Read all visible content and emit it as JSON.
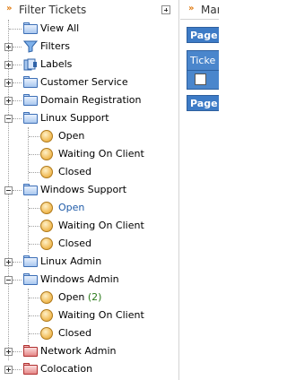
{
  "panel": {
    "title": "Filter Tickets"
  },
  "tree": {
    "view_all": "View All",
    "filters": "Filters",
    "labels": "Labels",
    "customer_service": "Customer Service",
    "domain_registration": "Domain Registration",
    "linux_support": {
      "label": "Linux Support",
      "open": "Open",
      "waiting": "Waiting On Client",
      "closed": "Closed"
    },
    "windows_support": {
      "label": "Windows Support",
      "open": "Open",
      "waiting": "Waiting On Client",
      "closed": "Closed"
    },
    "linux_admin": "Linux Admin",
    "windows_admin": {
      "label": "Windows Admin",
      "open": "Open",
      "open_count": "(2)",
      "waiting": "Waiting On Client",
      "closed": "Closed"
    },
    "network_admin": "Network Admin",
    "colocation": "Colocation"
  },
  "main": {
    "title": "Mar",
    "page_top": "Page",
    "ticket_header": "Ticke",
    "page_bottom": "Page"
  },
  "colors": {
    "accent_orange": "#e07a10",
    "active_link": "#1f5ba8",
    "count_green": "#2a7a1a",
    "bar_blue": "#3d7bc6"
  }
}
